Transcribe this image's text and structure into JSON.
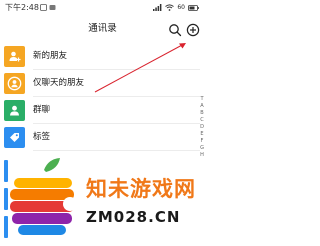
{
  "status_bar": {
    "time": "下午2:48",
    "battery": "60"
  },
  "header": {
    "title": "通讯录",
    "search_icon": "search-icon",
    "add_icon": "add-circle-icon"
  },
  "contacts": {
    "items": [
      {
        "label": "新的朋友",
        "icon": "add-friend-icon",
        "color": "#f5a623"
      },
      {
        "label": "仅聊天的朋友",
        "icon": "chat-friend-icon",
        "color": "#f5a623"
      },
      {
        "label": "群聊",
        "icon": "group-icon",
        "color": "#2aae67"
      },
      {
        "label": "标签",
        "icon": "tag-icon",
        "color": "#2c8ef0"
      }
    ]
  },
  "alpha_index": [
    "T",
    "A",
    "B",
    "C",
    "D",
    "E",
    "F",
    "G",
    "H"
  ],
  "watermark": {
    "cn": "知未游戏网",
    "en": "ZM028.CN",
    "colors": [
      "#4caf50",
      "#ffb300",
      "#f57c00",
      "#e53935",
      "#8e24aa",
      "#1e88e5"
    ]
  },
  "colors": {
    "accent_arrow": "#d9232e"
  }
}
